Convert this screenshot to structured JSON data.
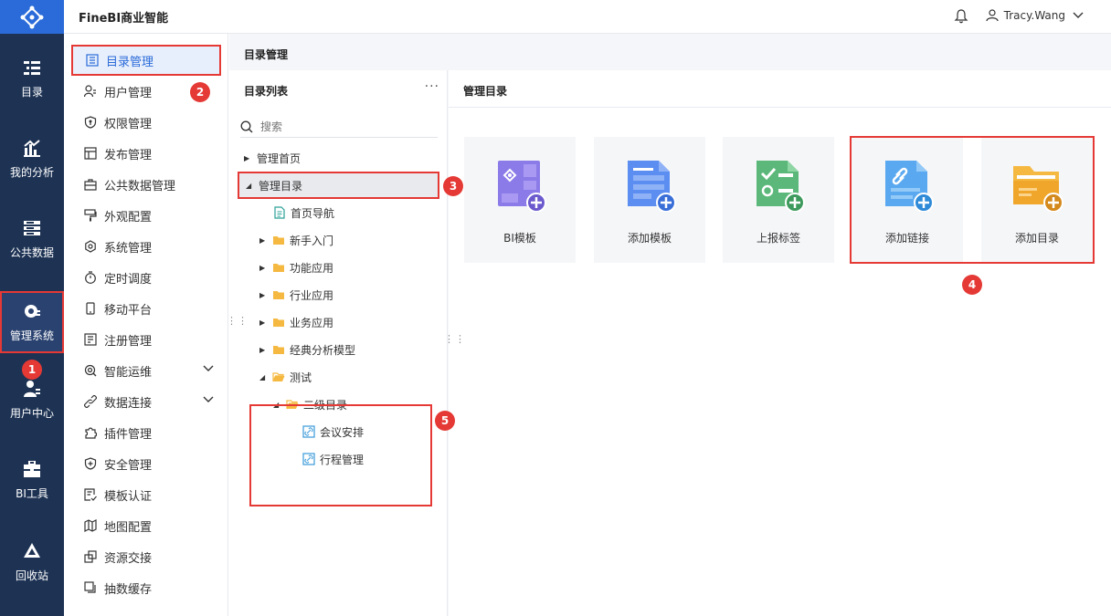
{
  "app": {
    "title": "FineBI商业智能"
  },
  "user": {
    "name": "Tracy.Wang"
  },
  "rail": [
    {
      "label": "目录",
      "icon": "catalog-icon"
    },
    {
      "label": "我的分析",
      "icon": "analysis-icon"
    },
    {
      "label": "公共数据",
      "icon": "public-data-icon"
    },
    {
      "label": "管理系统",
      "icon": "management-gear-icon",
      "active": true
    },
    {
      "label": "用户中心",
      "icon": "user-center-icon"
    },
    {
      "label": "BI工具",
      "icon": "toolbox-icon"
    },
    {
      "label": "回收站",
      "icon": "recycle-icon"
    }
  ],
  "nav": [
    {
      "label": "目录管理",
      "icon": "catalog-list-icon",
      "active": true
    },
    {
      "label": "用户管理",
      "icon": "user-manage-icon"
    },
    {
      "label": "权限管理",
      "icon": "permission-shield-icon"
    },
    {
      "label": "发布管理",
      "icon": "publish-icon"
    },
    {
      "label": "公共数据管理",
      "icon": "briefcase-icon"
    },
    {
      "label": "外观配置",
      "icon": "paint-brush-icon"
    },
    {
      "label": "系统管理",
      "icon": "system-gear-icon"
    },
    {
      "label": "定时调度",
      "icon": "timer-icon"
    },
    {
      "label": "移动平台",
      "icon": "mobile-icon"
    },
    {
      "label": "注册管理",
      "icon": "register-icon"
    },
    {
      "label": "智能运维",
      "icon": "ops-icon",
      "expandable": true
    },
    {
      "label": "数据连接",
      "icon": "link-icon",
      "expandable": true
    },
    {
      "label": "插件管理",
      "icon": "plugin-icon"
    },
    {
      "label": "安全管理",
      "icon": "security-shield-icon"
    },
    {
      "label": "模板认证",
      "icon": "template-cert-icon"
    },
    {
      "label": "地图配置",
      "icon": "map-icon"
    },
    {
      "label": "资源交接",
      "icon": "resource-handover-icon"
    },
    {
      "label": "抽数缓存",
      "icon": "cache-icon"
    }
  ],
  "breadcrumb": "目录管理",
  "tree": {
    "title": "目录列表",
    "more": "···",
    "search_placeholder": "搜索",
    "rows": [
      {
        "label": "管理首页",
        "arrow": "▶",
        "icon": ""
      },
      {
        "label": "管理目录",
        "arrow": "◢",
        "icon": "",
        "selected": true
      },
      {
        "label": "首页导航",
        "arrow": "",
        "icon": "doc-icon"
      },
      {
        "label": "新手入门",
        "arrow": "▶",
        "icon": "folder-icon"
      },
      {
        "label": "功能应用",
        "arrow": "▶",
        "icon": "folder-icon"
      },
      {
        "label": "行业应用",
        "arrow": "▶",
        "icon": "folder-icon"
      },
      {
        "label": "业务应用",
        "arrow": "▶",
        "icon": "folder-icon"
      },
      {
        "label": "经典分析模型",
        "arrow": "▶",
        "icon": "folder-icon"
      },
      {
        "label": "测试",
        "arrow": "◢",
        "icon": "folder-open-icon"
      },
      {
        "label": "二级目录",
        "arrow": "◢",
        "icon": "folder-open-icon"
      },
      {
        "label": "会议安排",
        "arrow": "",
        "icon": "link-file-icon"
      },
      {
        "label": "行程管理",
        "arrow": "",
        "icon": "link-file-icon"
      }
    ]
  },
  "content": {
    "title": "管理目录",
    "cards": [
      {
        "label": "BI模板",
        "icon": "bi-template-icon"
      },
      {
        "label": "添加模板",
        "icon": "add-template-icon"
      },
      {
        "label": "上报标签",
        "icon": "report-tag-icon"
      },
      {
        "label": "添加链接",
        "icon": "add-link-icon"
      },
      {
        "label": "添加目录",
        "icon": "add-folder-icon"
      }
    ]
  },
  "badges": [
    "1",
    "2",
    "3",
    "4",
    "5"
  ],
  "colors": {
    "rail_bg": "#1e3354",
    "accent": "#2a6bd9",
    "annotation_red": "#e53935"
  }
}
